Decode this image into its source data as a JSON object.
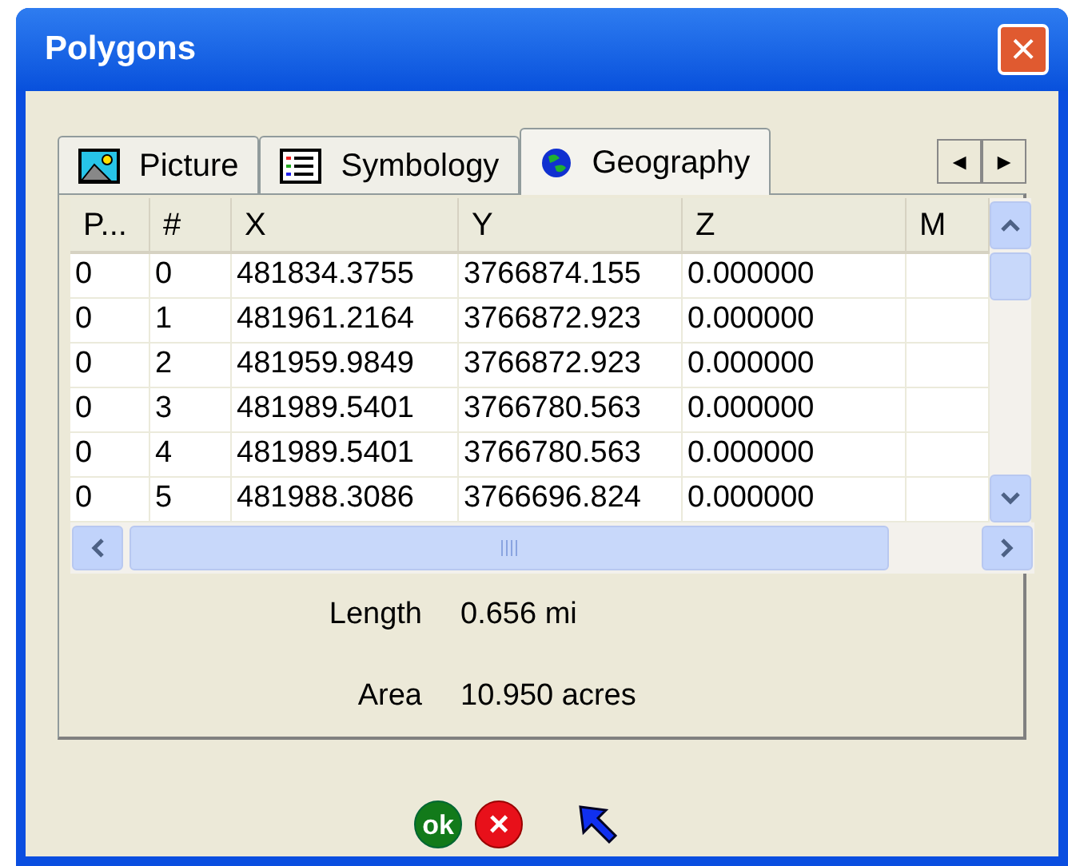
{
  "window": {
    "title": "Polygons",
    "close": "×"
  },
  "tabs": [
    {
      "label": "Picture",
      "kind": "picture",
      "selected": false
    },
    {
      "label": "Symbology",
      "kind": "list",
      "selected": false
    },
    {
      "label": "Geography",
      "kind": "globe",
      "selected": true
    }
  ],
  "tab_scroll": [
    "◄",
    "►"
  ],
  "table": {
    "columns": [
      "P...",
      "#",
      "X",
      "Y",
      "Z",
      "M"
    ],
    "rows": [
      [
        "0",
        "0",
        "481834.3755",
        "3766874.155",
        "0.000000",
        ""
      ],
      [
        "0",
        "1",
        "481961.2164",
        "3766872.923",
        "0.000000",
        ""
      ],
      [
        "0",
        "2",
        "481959.9849",
        "3766872.923",
        "0.000000",
        ""
      ],
      [
        "0",
        "3",
        "481989.5401",
        "3766780.563",
        "0.000000",
        ""
      ],
      [
        "0",
        "4",
        "481989.5401",
        "3766780.563",
        "0.000000",
        ""
      ],
      [
        "0",
        "5",
        "481988.3086",
        "3766696.824",
        "0.000000",
        ""
      ]
    ]
  },
  "measures": [
    {
      "label": "Length",
      "value": "0.656 mi"
    },
    {
      "label": "Area",
      "value": "10.950 acres"
    }
  ],
  "buttons": [
    {
      "kind": "ok",
      "label": "ok"
    },
    {
      "kind": "cancel",
      "label": "×"
    },
    {
      "kind": "pointer"
    }
  ]
}
